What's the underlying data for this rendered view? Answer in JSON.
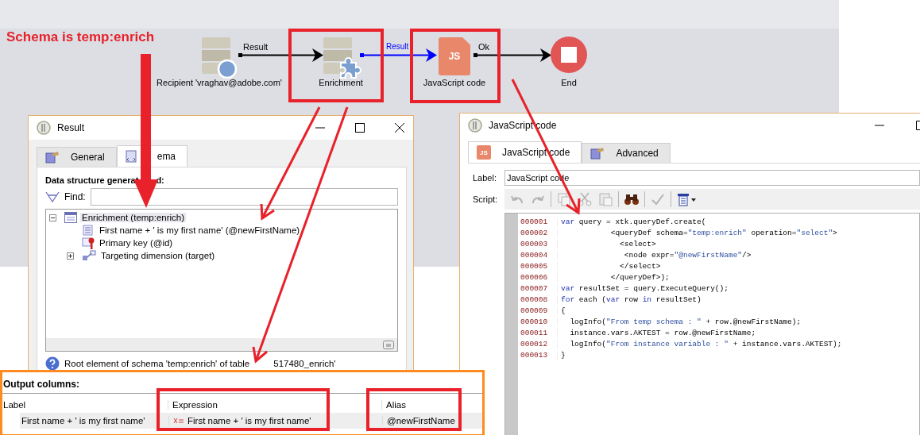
{
  "annotation": {
    "caption": "Schema is temp:enrich"
  },
  "workflow": {
    "nodes": [
      {
        "kind": "recipient",
        "label": "Recipient 'vraghav@adobe.com'"
      },
      {
        "kind": "enrichment",
        "label": "Enrichment"
      },
      {
        "kind": "javascript",
        "label": "JavaScript code",
        "badge": "JS"
      },
      {
        "kind": "end",
        "label": "End"
      }
    ],
    "transitions": [
      {
        "label": "Result",
        "color": "#000000"
      },
      {
        "label": "Result",
        "color": "#0000ff"
      },
      {
        "label": "Ok",
        "color": "#000000"
      }
    ]
  },
  "result_window": {
    "title": "Result",
    "tabs": [
      {
        "label": "General",
        "kind": "general",
        "selected": false
      },
      {
        "label": "ema",
        "kind": "schema",
        "selected": true
      }
    ],
    "heading": [
      "Data structure generat",
      "d:"
    ],
    "find_label": "Find:",
    "tree": [
      {
        "label": "Enrichment (temp:enrich)",
        "kind": "table",
        "expanded": true,
        "selected": true,
        "children": [
          {
            "label": "First name + ' is my first name' (@newFirstName)",
            "kind": "field",
            "selected": false
          },
          {
            "label": "Primary key (@id)",
            "kind": "key",
            "selected": false
          },
          {
            "label": "Targeting dimension (target)",
            "kind": "link",
            "expanded": false,
            "selected": false
          }
        ]
      }
    ],
    "status": [
      "Root element of schema 'temp:enrich' of table",
      "517480_enrich'"
    ]
  },
  "js_window": {
    "title": "JavaScript code",
    "tabs": [
      {
        "label": "JavaScript code",
        "kind": "js",
        "icon_text": "JS",
        "selected": true
      },
      {
        "label": "Advanced",
        "kind": "general",
        "selected": false
      }
    ],
    "label_caption": "Label:",
    "label_value": "JavaScript code",
    "script_caption": "Script:",
    "toolbar": [
      {
        "kind": "undo",
        "disabled": true
      },
      {
        "kind": "redo",
        "disabled": true
      },
      {
        "kind": "sep"
      },
      {
        "kind": "copy",
        "disabled": true
      },
      {
        "kind": "cut",
        "disabled": true
      },
      {
        "kind": "paste",
        "disabled": true
      },
      {
        "kind": "sep"
      },
      {
        "kind": "find",
        "disabled": false
      },
      {
        "kind": "sep"
      },
      {
        "kind": "check",
        "disabled": true
      },
      {
        "kind": "sep"
      },
      {
        "kind": "insert",
        "disabled": false
      }
    ],
    "code": [
      {
        "number": "000001",
        "segments": [
          {
            "kind": "kw",
            "text": "var"
          },
          {
            "kind": "plain",
            "text": " query = xtk.queryDef.create("
          }
        ]
      },
      {
        "number": "000002",
        "segments": [
          {
            "kind": "plain",
            "text": "           <queryDef schema="
          },
          {
            "kind": "str",
            "text": "\"temp:enrich\""
          },
          {
            "kind": "plain",
            "text": " operation="
          },
          {
            "kind": "str",
            "text": "\"select\""
          },
          {
            "kind": "plain",
            "text": ">"
          }
        ]
      },
      {
        "number": "000003",
        "segments": [
          {
            "kind": "plain",
            "text": "             <select>"
          }
        ]
      },
      {
        "number": "000004",
        "segments": [
          {
            "kind": "plain",
            "text": "              <node expr="
          },
          {
            "kind": "str",
            "text": "\"@newFirstName\""
          },
          {
            "kind": "plain",
            "text": "/>"
          }
        ]
      },
      {
        "number": "000005",
        "segments": [
          {
            "kind": "plain",
            "text": "             </select>"
          }
        ]
      },
      {
        "number": "000006",
        "segments": [
          {
            "kind": "plain",
            "text": "           </queryDef>);"
          }
        ]
      },
      {
        "number": "000007",
        "segments": [
          {
            "kind": "kw",
            "text": "var"
          },
          {
            "kind": "plain",
            "text": " resultSet = query.ExecuteQuery();"
          }
        ]
      },
      {
        "number": "000008",
        "segments": [
          {
            "kind": "kw",
            "text": "for"
          },
          {
            "kind": "plain",
            "text": " each ("
          },
          {
            "kind": "kw",
            "text": "var"
          },
          {
            "kind": "plain",
            "text": " row "
          },
          {
            "kind": "kw",
            "text": "in"
          },
          {
            "kind": "plain",
            "text": " resultSet)"
          }
        ]
      },
      {
        "number": "000009",
        "segments": [
          {
            "kind": "plain",
            "text": "{"
          }
        ]
      },
      {
        "number": "000010",
        "segments": [
          {
            "kind": "plain",
            "text": "  logInfo("
          },
          {
            "kind": "str",
            "text": "\"From temp schema : \""
          },
          {
            "kind": "plain",
            "text": " + row.@newFirstName);"
          }
        ]
      },
      {
        "number": "000011",
        "segments": [
          {
            "kind": "plain",
            "text": "  instance.vars.AKTEST = row.@newFirstName;"
          }
        ]
      },
      {
        "number": "000012",
        "segments": [
          {
            "kind": "plain",
            "text": "  logInfo("
          },
          {
            "kind": "str",
            "text": "\"From instance variable : \""
          },
          {
            "kind": "plain",
            "text": " + instance.vars.AKTEST);"
          }
        ]
      },
      {
        "number": "000013",
        "segments": [
          {
            "kind": "plain",
            "text": "}"
          }
        ]
      }
    ]
  },
  "output_columns": {
    "title": "Output columns:",
    "columns": [
      "Label",
      "Expression",
      "Alias"
    ],
    "rows": [
      {
        "cells": [
          "First name + ' is my first name'",
          "First name + ' is my first name'",
          "@newFirstName"
        ]
      }
    ]
  }
}
